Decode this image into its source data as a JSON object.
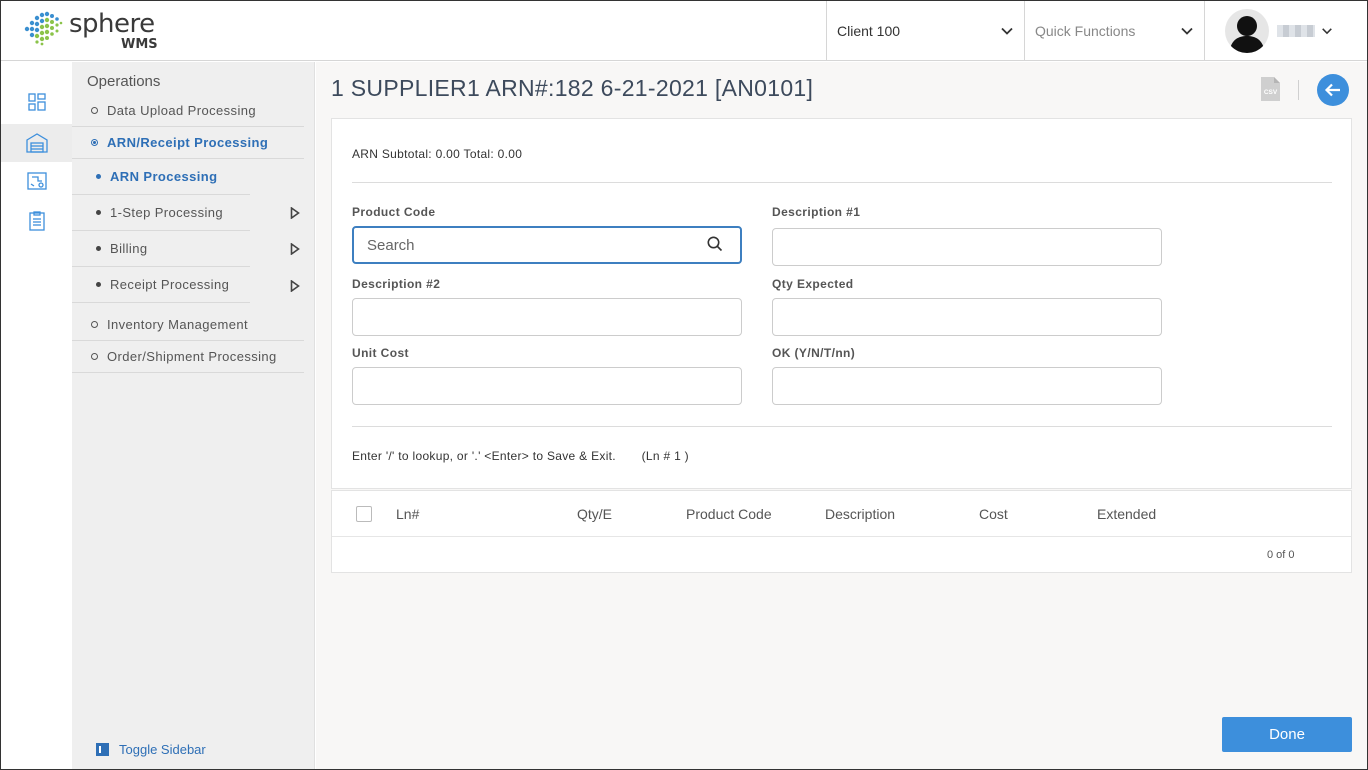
{
  "header": {
    "logo_text": "sphere",
    "logo_sub": "WMS",
    "client": "Client 100",
    "quick_functions": "Quick Functions"
  },
  "sidebar": {
    "title": "Operations",
    "items": [
      {
        "label": "Data Upload Processing"
      },
      {
        "label": "ARN/Receipt Processing"
      },
      {
        "label": "Inventory Management"
      },
      {
        "label": "Order/Shipment Processing"
      }
    ],
    "subitems": [
      {
        "label": "ARN Processing"
      },
      {
        "label": "1-Step Processing"
      },
      {
        "label": "Billing"
      },
      {
        "label": "Receipt Processing"
      }
    ],
    "toggle": "Toggle Sidebar"
  },
  "main": {
    "title": "1 SUPPLIER1 ARN#:182 6-21-2021 [AN0101]",
    "csv_label": "CSV",
    "subtotal": "ARN Subtotal: 0.00 Total: 0.00",
    "fields": {
      "product_code": {
        "label": "Product Code",
        "placeholder": "Search"
      },
      "description1": {
        "label": "Description #1"
      },
      "description2": {
        "label": "Description #2"
      },
      "qty_expected": {
        "label": "Qty Expected"
      },
      "unit_cost": {
        "label": "Unit Cost"
      },
      "ok": {
        "label": "OK (Y/N/T/nn)"
      }
    },
    "hint": "Enter '/' to lookup, or '.' <Enter> to Save & Exit.",
    "line_no": "(Ln # 1 )",
    "table": {
      "columns": [
        "Ln#",
        "Qty/E",
        "Product Code",
        "Description",
        "Cost",
        "Extended"
      ],
      "pager": "0 of 0"
    },
    "done_label": "Done"
  },
  "colors": {
    "accent": "#3d8fdc",
    "active_link": "#2e6fb6"
  }
}
